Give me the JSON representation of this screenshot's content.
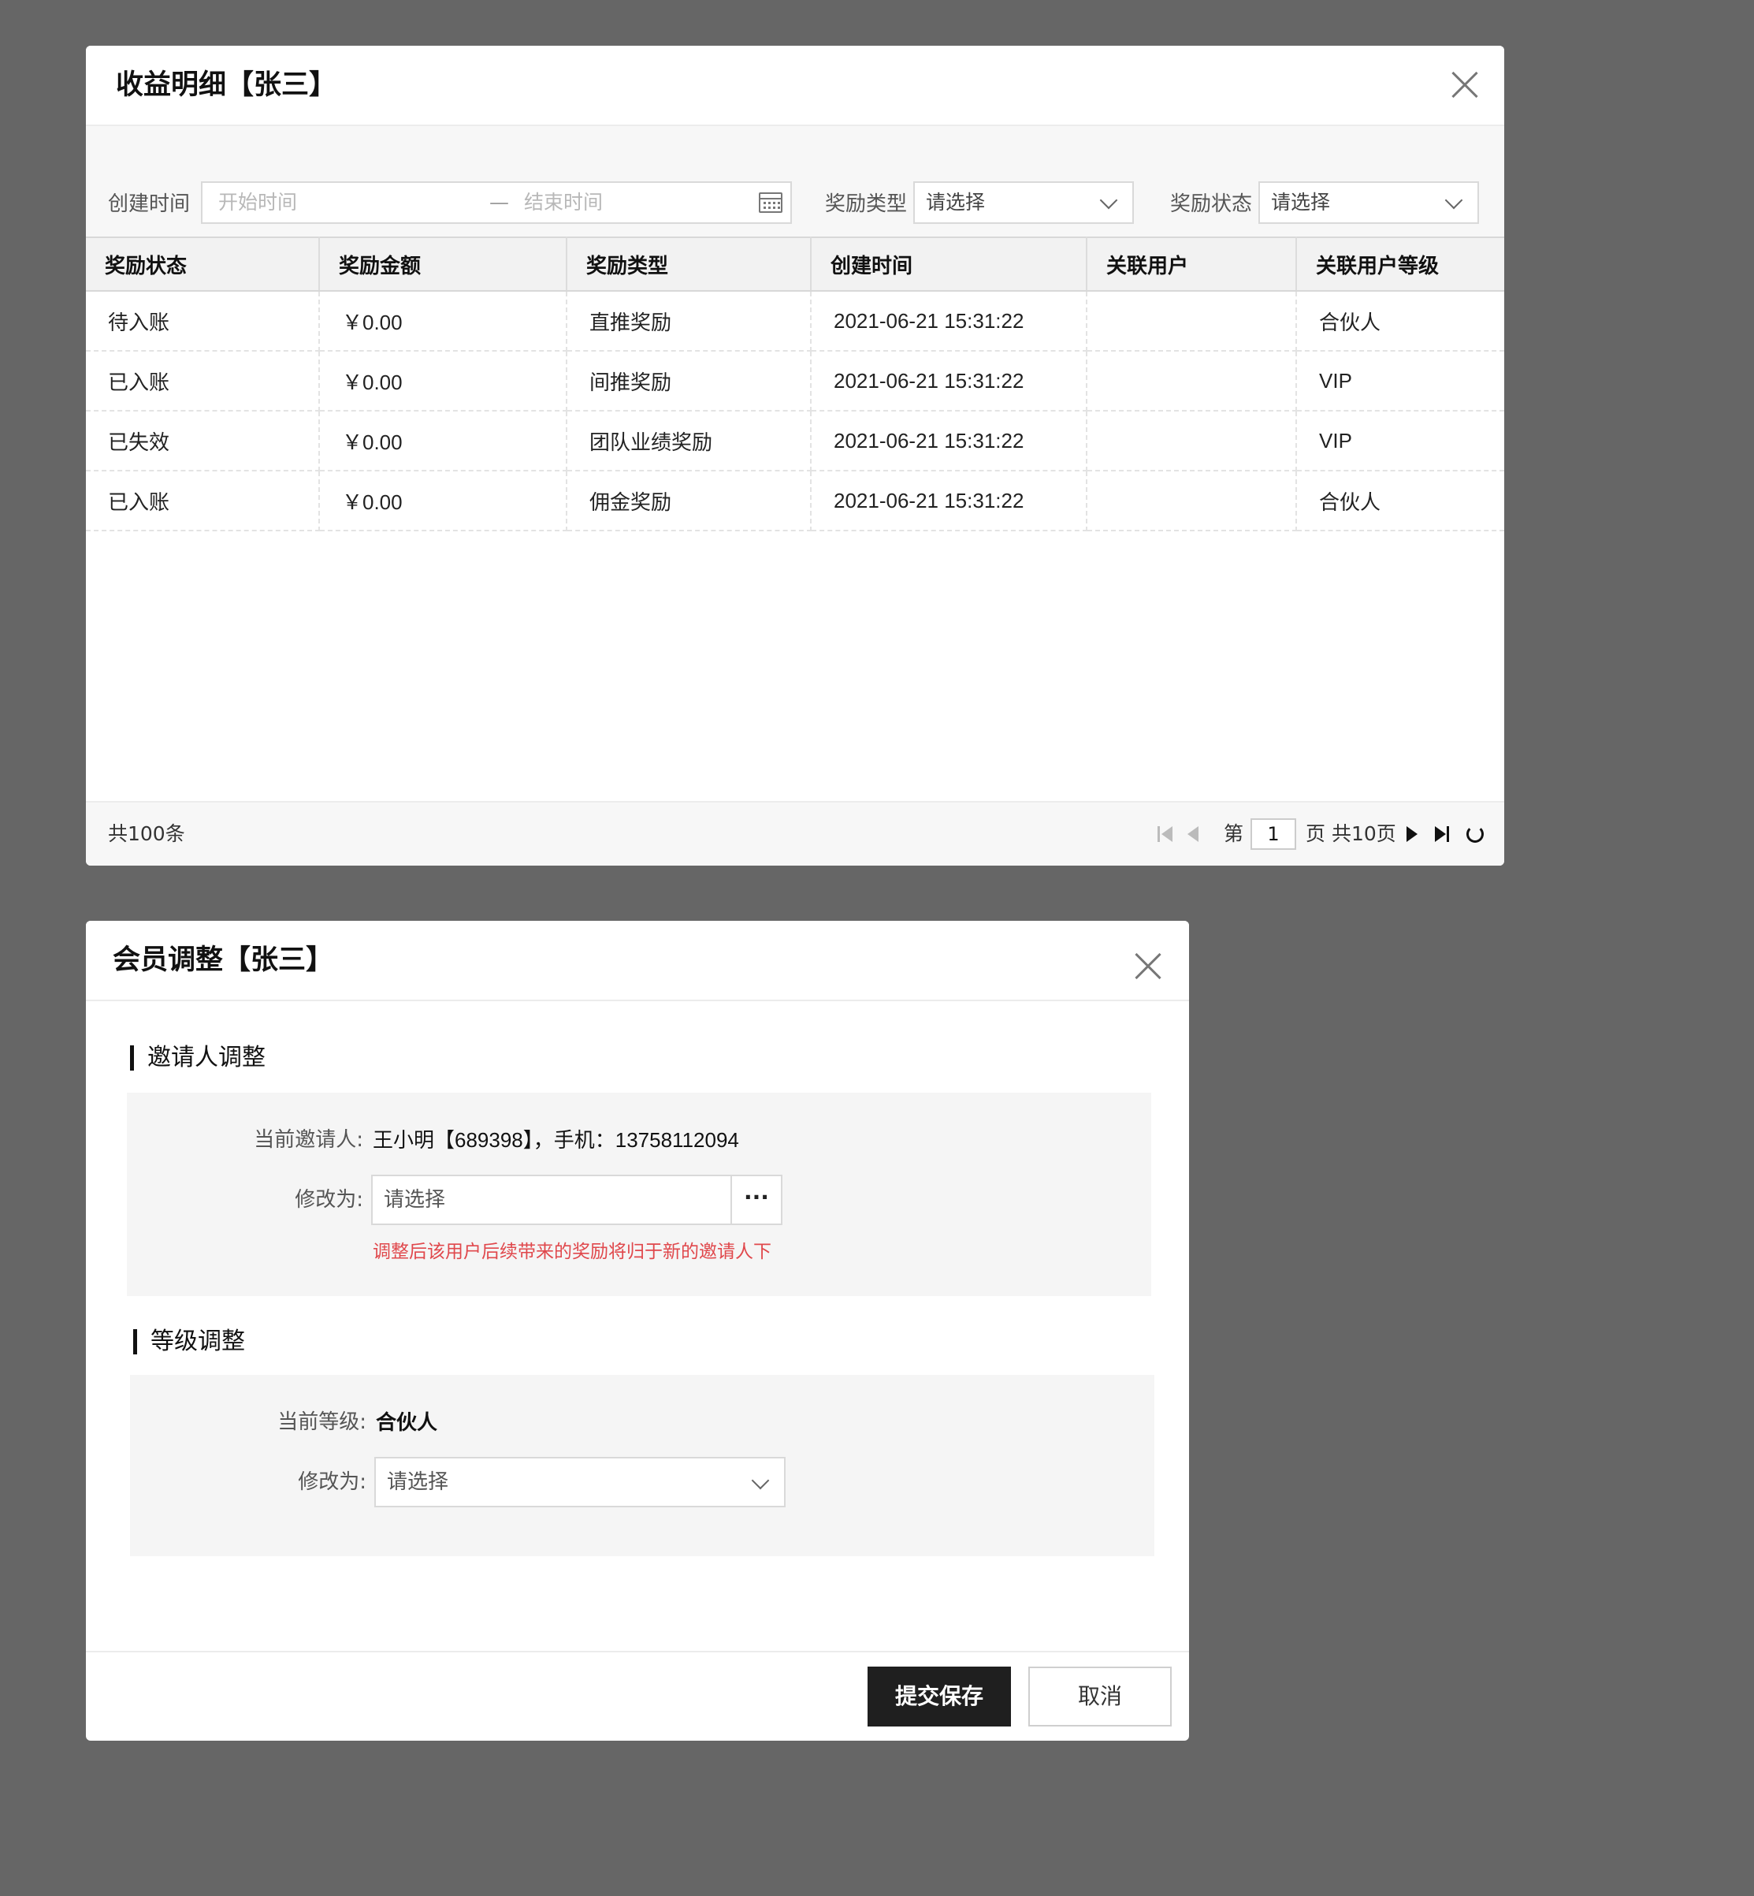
{
  "earnings_dialog": {
    "title": "收益明细【张三】",
    "filters": {
      "created_time_label": "创建时间",
      "start_placeholder": "开始时间",
      "range_separator": "—",
      "end_placeholder": "结束时间",
      "reward_type_label": "奖励类型",
      "reward_type_value": "请选择",
      "reward_status_label": "奖励状态",
      "reward_status_value": "请选择"
    },
    "table": {
      "headers": [
        "奖励状态",
        "奖励金额",
        "奖励类型",
        "创建时间",
        "关联用户",
        "关联用户等级"
      ],
      "rows": [
        {
          "status": "待入账",
          "amount": "￥0.00",
          "type": "直推奖励",
          "created": "2021-06-21 15:31:22",
          "user": "",
          "level": "合伙人"
        },
        {
          "status": "已入账",
          "amount": "￥0.00",
          "type": "间推奖励",
          "created": "2021-06-21 15:31:22",
          "user": "",
          "level": "VIP"
        },
        {
          "status": "已失效",
          "amount": "￥0.00",
          "type": "团队业绩奖励",
          "created": "2021-06-21 15:31:22",
          "user": "",
          "level": "VIP"
        },
        {
          "status": "已入账",
          "amount": "￥0.00",
          "type": "佣金奖励",
          "created": "2021-06-21 15:31:22",
          "user": "",
          "level": "合伙人"
        }
      ]
    },
    "pagination": {
      "total": "共100条",
      "page_prefix": "第",
      "current_page": "1",
      "page_suffix": "页 共10页"
    },
    "status_colors": {
      "pending": "#1a7fe0",
      "expired": "#b0b0b0"
    }
  },
  "member_dialog": {
    "title": "会员调整【张三】",
    "inviter_section": {
      "title": "邀请人调整",
      "current_label": "当前邀请人:",
      "current_value": "王小明【689398】，手机：13758112094",
      "change_label": "修改为:",
      "change_placeholder": "请选择",
      "picker_button": "···",
      "hint": "调整后该用户后续带来的奖励将归于新的邀请人下"
    },
    "level_section": {
      "title": "等级调整",
      "current_label": "当前等级:",
      "current_value": "合伙人",
      "change_label": "修改为:",
      "change_placeholder": "请选择"
    },
    "footer": {
      "submit": "提交保存",
      "cancel": "取消"
    }
  }
}
